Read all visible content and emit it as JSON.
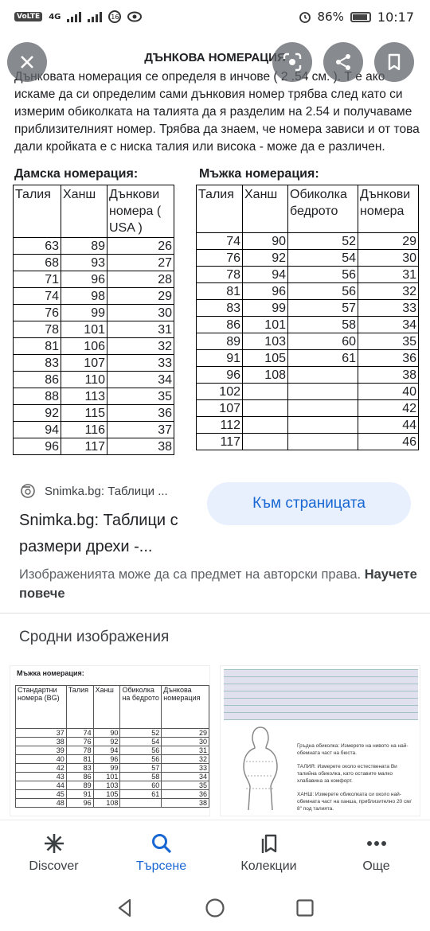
{
  "status_bar": {
    "volte": "VoLTE",
    "network": "4G",
    "circle_badge": "16",
    "battery": "86%",
    "time": "10:17"
  },
  "image": {
    "title": "ДЪНКОВА НОМЕРАЦИЯ",
    "intro": "Дънковата номерация се определя в инчове ( 2 .54 см. ). Т е ако искаме да си определим сами дънковия номер трябва след като си измерим обиколката на талията да я разделим на 2.54 и получаваме приблизителният номер. Трябва да знаем, че номера зависи и от това дали кройката е с ниска талия или висока - може да е различен.",
    "women": {
      "title": "Дамска номерация:",
      "headers": [
        "Талия",
        "Ханш",
        "Дънкови номера ( USA )"
      ],
      "rows": [
        [
          "63",
          "89",
          "26"
        ],
        [
          "68",
          "93",
          "27"
        ],
        [
          "71",
          "96",
          "28"
        ],
        [
          "74",
          "98",
          "29"
        ],
        [
          "76",
          "99",
          "30"
        ],
        [
          "78",
          "101",
          "31"
        ],
        [
          "81",
          "106",
          "32"
        ],
        [
          "83",
          "107",
          "33"
        ],
        [
          "86",
          "110",
          "34"
        ],
        [
          "88",
          "113",
          "35"
        ],
        [
          "92",
          "115",
          "36"
        ],
        [
          "94",
          "116",
          "37"
        ],
        [
          "96",
          "117",
          "38"
        ]
      ]
    },
    "men": {
      "title": "Мъжка номерация:",
      "headers": [
        "Талия",
        "Ханш",
        "Обиколка бедрото",
        "Дънкови номера"
      ],
      "rows": [
        [
          "74",
          "90",
          "52",
          "29"
        ],
        [
          "76",
          "92",
          "54",
          "30"
        ],
        [
          "78",
          "94",
          "56",
          "31"
        ],
        [
          "81",
          "96",
          "56",
          "32"
        ],
        [
          "83",
          "99",
          "57",
          "33"
        ],
        [
          "86",
          "101",
          "58",
          "34"
        ],
        [
          "89",
          "103",
          "60",
          "35"
        ],
        [
          "91",
          "105",
          "61",
          "36"
        ],
        [
          "96",
          "108",
          "",
          "38"
        ],
        [
          "102",
          "",
          "",
          "40"
        ],
        [
          "107",
          "",
          "",
          "42"
        ],
        [
          "112",
          "",
          "",
          "44"
        ],
        [
          "117",
          "",
          "",
          "46"
        ]
      ]
    }
  },
  "source": {
    "site_label": "Snimka.bg: Таблици ...",
    "visit_label": "Към страницата",
    "title": "Snimka.bg: Таблици с размери дрехи -...",
    "rights_text": "Изображенията може да са предмет на авторски права.",
    "learn_more": "Научете повече"
  },
  "related": {
    "title": "Сродни изображения",
    "thumb1": {
      "caption": "Мъжка номерация:",
      "headers": [
        "Стандартни номера (BG)",
        "Талия",
        "Ханш",
        "Обиколка на бедрото",
        "Дънкова номерация"
      ],
      "rows": [
        [
          "37",
          "74",
          "90",
          "52",
          "29"
        ],
        [
          "38",
          "76",
          "92",
          "54",
          "30"
        ],
        [
          "39",
          "78",
          "94",
          "56",
          "31"
        ],
        [
          "40",
          "81",
          "96",
          "56",
          "32"
        ],
        [
          "42",
          "83",
          "99",
          "57",
          "33"
        ],
        [
          "43",
          "86",
          "101",
          "58",
          "34"
        ],
        [
          "44",
          "89",
          "103",
          "60",
          "35"
        ],
        [
          "45",
          "91",
          "105",
          "61",
          "36"
        ],
        [
          "48",
          "96",
          "108",
          "",
          "38"
        ]
      ]
    },
    "thumb2": {
      "lines": [
        "Гръдна обиколка: Измерете на нивото на най-обемната част на бюста.",
        "ТАЛИЯ: Измерете около естествената Ви талийна обиколка, като оставите малко хлабавина за комфорт.",
        "ХАНШ: Измерете обиколката си около най-обемната част на ханша, приблизително 20 см/ 8\" под талията."
      ]
    }
  },
  "bottom_nav": {
    "discover": "Discover",
    "search": "Търсене",
    "collections": "Колекции",
    "more": "Още"
  },
  "colors": {
    "accent": "#1967d2",
    "visit_bg": "#e8f0fe",
    "overlay_btn": "#5f6368"
  }
}
